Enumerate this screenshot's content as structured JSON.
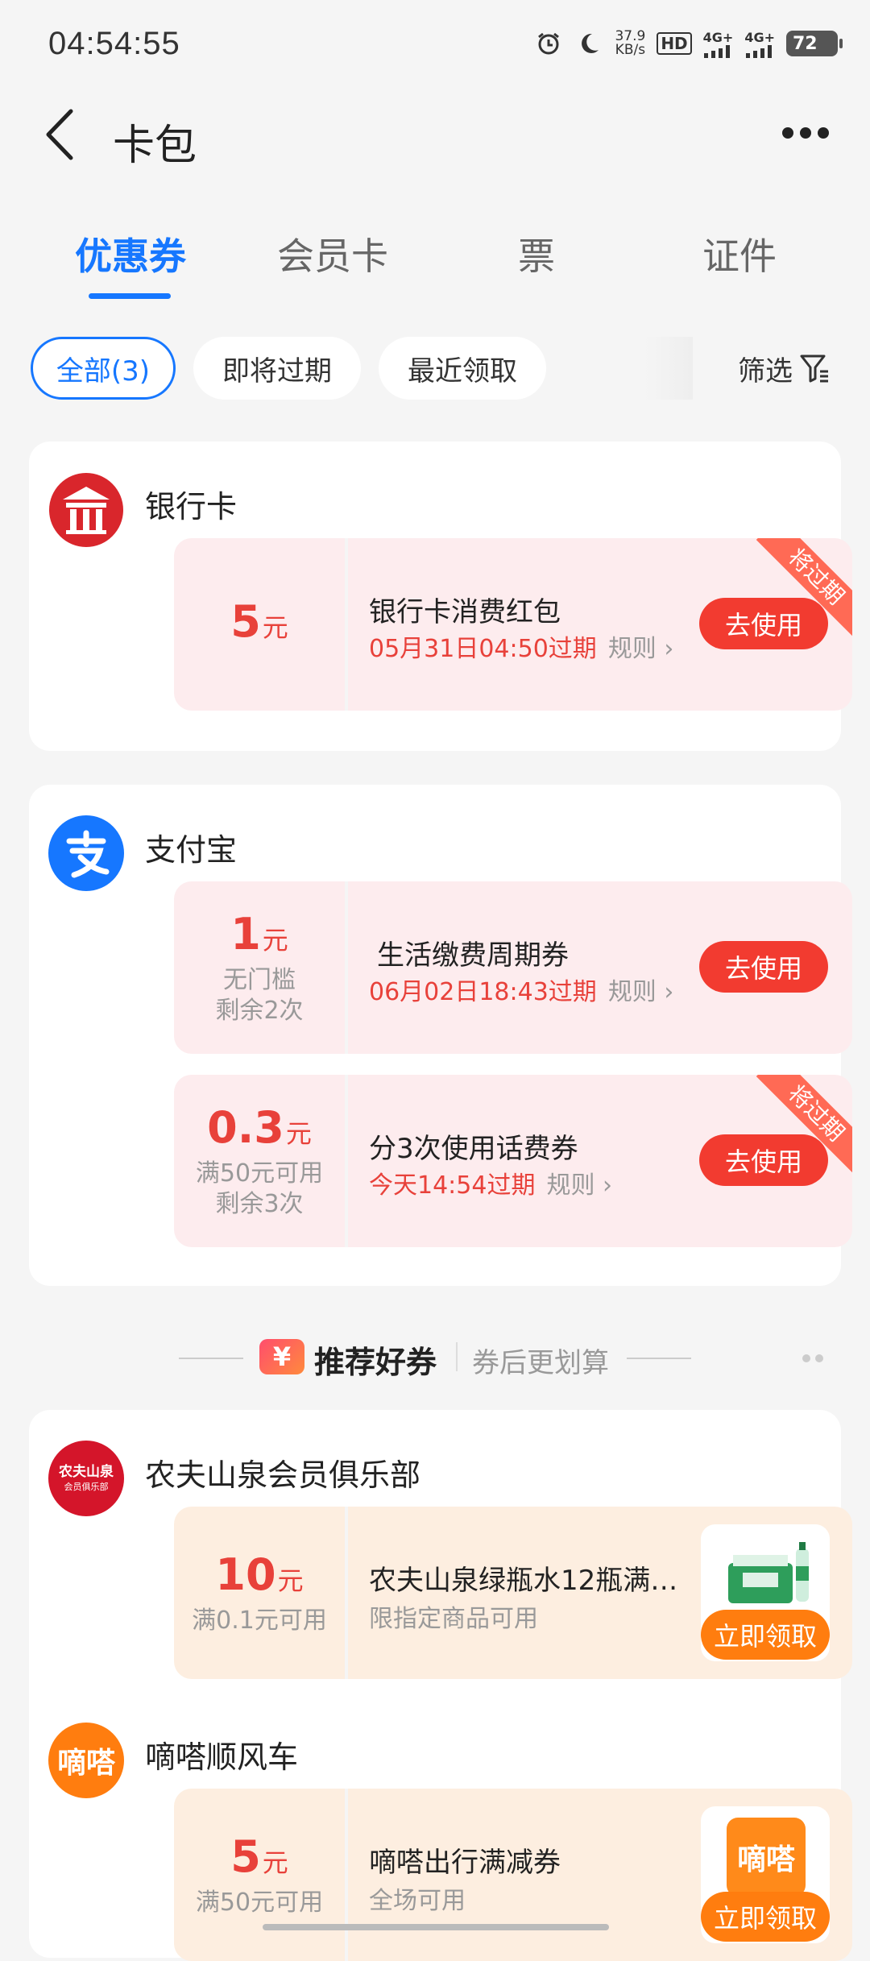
{
  "status_bar": {
    "time": "04:54:55",
    "net_speed_value": "37.9",
    "net_speed_unit": "KB/s",
    "hd_label": "HD",
    "network_1": "4G+",
    "network_2": "4G+",
    "battery": "72"
  },
  "header": {
    "title": "卡包"
  },
  "tabs": [
    {
      "label": "优惠券",
      "active": true
    },
    {
      "label": "会员卡",
      "active": false
    },
    {
      "label": "票",
      "active": false
    },
    {
      "label": "证件",
      "active": false
    }
  ],
  "filters": {
    "chips": [
      {
        "label": "全部(3)",
        "active": true
      },
      {
        "label": "即将过期",
        "active": false
      },
      {
        "label": "最近领取",
        "active": false
      }
    ],
    "filter_label": "筛选"
  },
  "my_coupons": [
    {
      "merchant": "银行卡",
      "coupons": [
        {
          "amount": "5",
          "unit": "元",
          "title": "银行卡消费红包",
          "expire": "05月31日04:50过期",
          "rules": "规则",
          "action": "去使用",
          "ribbon": "将过期"
        }
      ]
    },
    {
      "merchant": "支付宝",
      "coupons": [
        {
          "amount": "1",
          "unit": "元",
          "cond1": "无门槛",
          "cond2": "剩余2次",
          "title": "生活缴费周期券",
          "expire": "06月02日18:43过期",
          "rules": "规则",
          "action": "去使用"
        },
        {
          "amount": "0.3",
          "unit": "元",
          "cond1": "满50元可用",
          "cond2": "剩余3次",
          "title": "分3次使用话费券",
          "expire": "今天14:54过期",
          "rules": "规则",
          "action": "去使用",
          "ribbon": "将过期"
        }
      ]
    }
  ],
  "recommend": {
    "badge": "¥",
    "title": "推荐好券",
    "subtitle": "券后更划算"
  },
  "recommended": [
    {
      "merchant": "农夫山泉会员俱乐部",
      "logo_line1": "农夫山泉",
      "logo_line2": "会员俱乐部",
      "amount": "10",
      "unit": "元",
      "cond": "满0.1元可用",
      "title": "农夫山泉绿瓶水12瓶满…",
      "sub": "限指定商品可用",
      "action": "立即领取"
    },
    {
      "merchant": "嘀嗒顺风车",
      "logo_text": "嘀嗒",
      "amount": "5",
      "unit": "元",
      "cond": "满50元可用",
      "title": "嘀嗒出行满减券",
      "sub": "全场可用",
      "action": "立即领取"
    }
  ],
  "colors": {
    "accent": "#1677ff",
    "red": "#e8413a",
    "button_red": "#f23b30",
    "orange": "#ff7d0f"
  }
}
